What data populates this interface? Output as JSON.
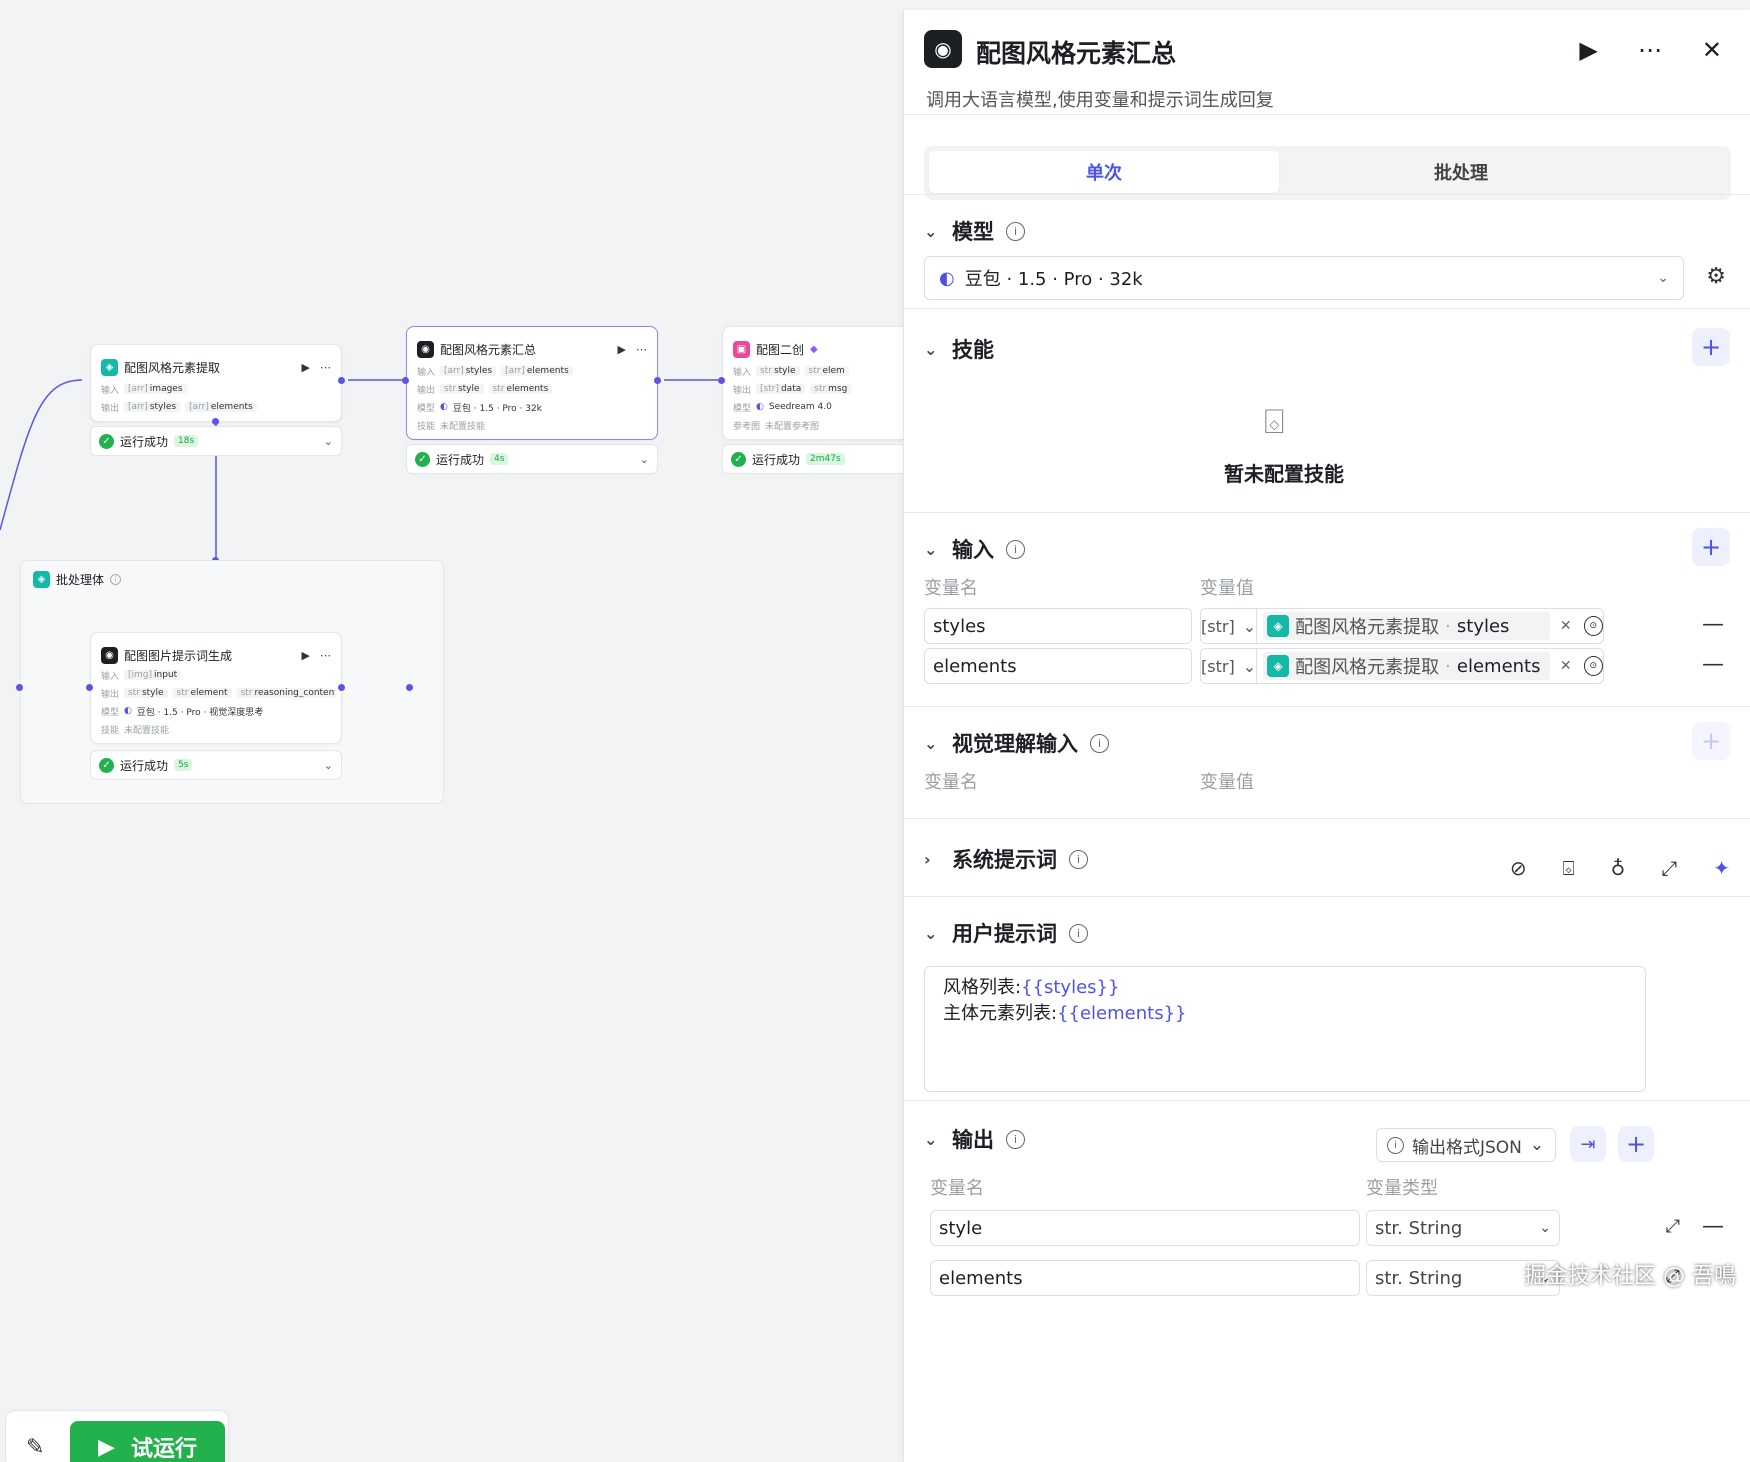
{
  "canvas": {
    "node1": {
      "title": "配图风格元素提取",
      "input_label": "输入",
      "input_type": "[arr]",
      "input": "images",
      "output_label": "输出",
      "out_type1": "[arr]",
      "out1": "styles",
      "out_type2": "[arr]",
      "out2": "elements",
      "status": "运行成功",
      "time": "18s"
    },
    "node2": {
      "title": "配图风格元素汇总",
      "input_label": "输入",
      "in_type1": "[arr]",
      "in1": "styles",
      "in_type2": "[arr]",
      "in2": "elements",
      "output_label": "输出",
      "out_type1": "str",
      "out1": "style",
      "out_type2": "str",
      "out2": "elements",
      "model_label": "模型",
      "model": "豆包 · 1.5 · Pro · 32k",
      "skill_label": "技能",
      "skill": "未配置技能",
      "status": "运行成功",
      "time": "4s"
    },
    "node3": {
      "title": "配图二创",
      "input_label": "输入",
      "in_type1": "str",
      "in1": "style",
      "in_type2": "str",
      "in2": "elem",
      "output_label": "输出",
      "out_type1": "[str]",
      "out1": "data",
      "out_type2": "str",
      "out2": "msg",
      "model_label": "模型",
      "model": "Seedream 4.0",
      "ref_label": "参考图",
      "ref": "未配置参考图",
      "status": "运行成功",
      "time": "2m47s"
    },
    "batch": {
      "title": "批处理体"
    },
    "node4": {
      "title": "配图图片提示词生成",
      "input_label": "输入",
      "in_type1": "[img]",
      "in1": "input",
      "output_label": "输出",
      "out_type1": "str",
      "out1": "style",
      "out_type2": "str",
      "out2": "element",
      "out_type3": "str",
      "out3": "reasoning_content",
      "model_label": "模型",
      "model": "豆包 · 1.5 · Pro · 视觉深度思考",
      "skill_label": "技能",
      "skill": "未配置技能",
      "status": "运行成功",
      "time": "5s"
    }
  },
  "toolbar": {
    "run_label": "试运行"
  },
  "panel": {
    "title": "配图风格元素汇总",
    "description": "调用大语言模型,使用变量和提示词生成回复",
    "tabs": [
      "单次",
      "批处理"
    ],
    "model_section": "模型",
    "model_value": "豆包 · 1.5 · Pro · 32k",
    "skills_section": "技能",
    "skills_empty": "暂未配置技能",
    "input_section": "输入",
    "col_var_name": "变量名",
    "col_var_value": "变量值",
    "inputs": [
      {
        "name": "styles",
        "type": "[str]",
        "source": "配图风格元素提取",
        "field": "styles"
      },
      {
        "name": "elements",
        "type": "[str]",
        "source": "配图风格元素提取",
        "field": "elements"
      }
    ],
    "vision_section": "视觉理解输入",
    "system_prompt_section": "系统提示词",
    "user_prompt_section": "用户提示词",
    "user_prompt_line1_label": "风格列表:",
    "user_prompt_line1_var": "{{styles}}",
    "user_prompt_line2_label": "主体元素列表:",
    "user_prompt_line2_var": "{{elements}}",
    "output_section": "输出",
    "output_format": "输出格式JSON",
    "col_var_type": "变量类型",
    "outputs": [
      {
        "name": "style",
        "type": "str. String"
      },
      {
        "name": "elements",
        "type": "str. String"
      }
    ]
  },
  "watermark": "掘金技术社区 @ 吾鳴"
}
